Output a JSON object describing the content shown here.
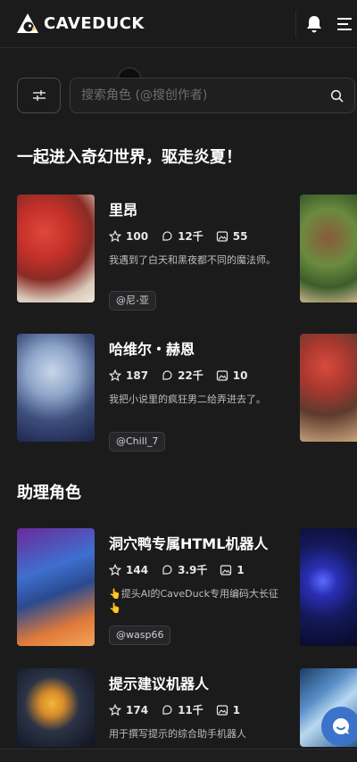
{
  "header": {
    "brand": "CAVEDUCK",
    "icons": [
      "caveduck-logo-icon",
      "bell-icon",
      "menu-icon"
    ]
  },
  "search": {
    "placeholder": "搜索角色 (@搜创作者)",
    "value": ""
  },
  "sections": [
    {
      "title": "一起进入奇幻世界，驱走炎夏！",
      "cards": [
        {
          "name": "里昂",
          "likes": "100",
          "chats": "12千",
          "images": "55",
          "description": "我遇到了白天和黑夜都不同的魔法师。",
          "author": "@尼-亚"
        },
        {
          "name": "哈维尔・赫恩",
          "likes": "187",
          "chats": "22千",
          "images": "10",
          "description": "我把小说里的疯狂男二给弄进去了。",
          "author": "@Chill_7"
        }
      ]
    },
    {
      "title": "助理角色",
      "cards": [
        {
          "name": "洞穴鸭专属HTML机器人",
          "likes": "144",
          "chats": "3.9千",
          "images": "1",
          "description": "👆提头AI的CaveDuck专用编码大长征👆",
          "author": "@wasp66"
        },
        {
          "name": "提示建议机器人",
          "likes": "174",
          "chats": "11千",
          "images": "1",
          "description": "用于撰写提示的综合助手机器人",
          "author": ""
        }
      ]
    }
  ],
  "colors": {
    "background": "#1b1b1c",
    "accent": "#3a73c9"
  }
}
